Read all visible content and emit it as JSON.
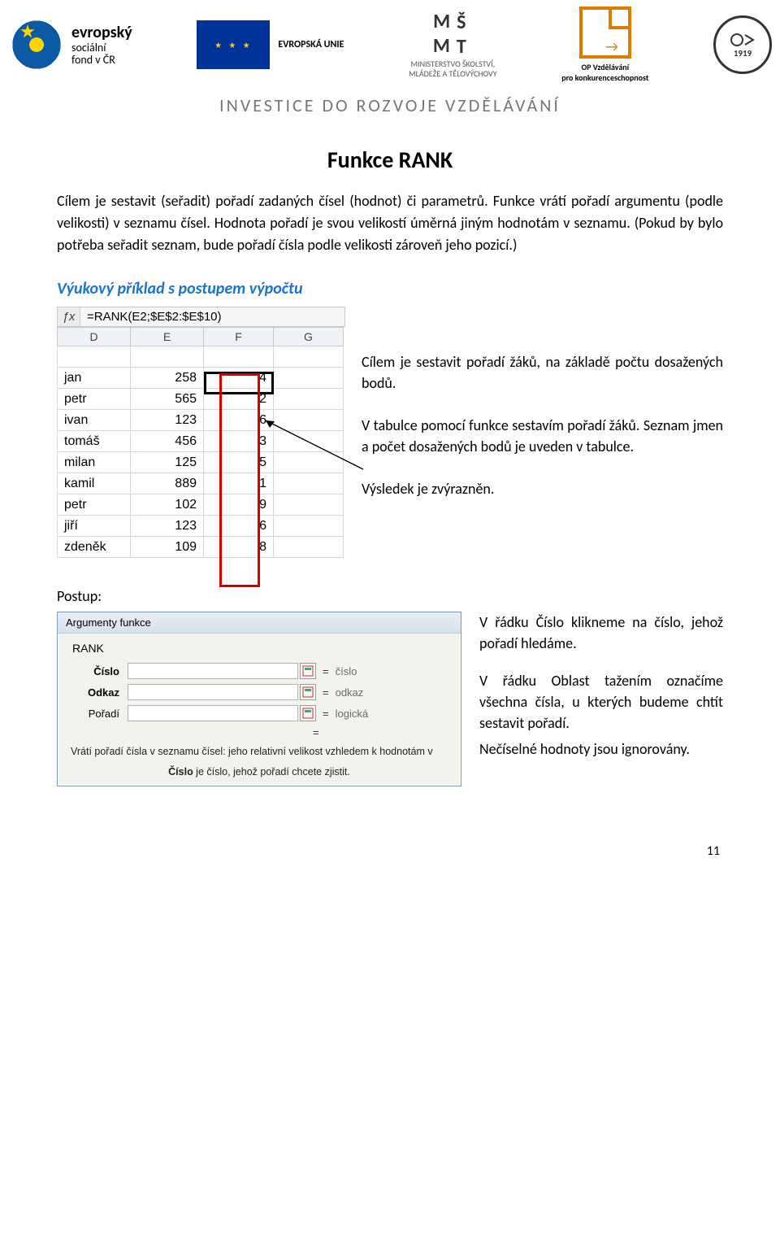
{
  "header": {
    "esf_big": "evropský",
    "esf_l2": "sociální",
    "esf_l3": "fond v ČR",
    "eu_label": "EVROPSKÁ UNIE",
    "msmt_top": "MŠMT",
    "msmt_l1": "MINISTERSTVO ŠKOLSTVÍ,",
    "msmt_l2": "MLÁDEŽE A TĚLOVÝCHOVY",
    "opvk_l1": "OP Vzdělávání",
    "opvk_l2": "pro konkurenceschopnost",
    "school_year": "1919",
    "slogan": "INVESTICE DO ROZVOJE VZDĚLÁVÁNÍ"
  },
  "title": "Funkce RANK",
  "intro_p1": "Cílem je sestavit (seřadit) pořadí zadaných čísel (hodnot) či parametrů. Funkce vrátí pořadí argumentu (podle velikosti) v seznamu čísel. Hodnota pořadí je svou velikostí úměrná jiným hodnotám v seznamu. (Pokud by bylo potřeba seřadit seznam, bude pořadí čísla podle velikosti zároveň jeho pozicí.)",
  "example_heading": "Výukový příklad s postupem výpočtu",
  "formula": "=RANK(E2;$E$2:$E$10)",
  "columns": [
    "D",
    "E",
    "F",
    "G"
  ],
  "rows": [
    {
      "name": "jan",
      "pts": 258,
      "rank": 4
    },
    {
      "name": "petr",
      "pts": 565,
      "rank": 2
    },
    {
      "name": "ivan",
      "pts": 123,
      "rank": 6
    },
    {
      "name": "tomáš",
      "pts": 456,
      "rank": 3
    },
    {
      "name": "milan",
      "pts": 125,
      "rank": 5
    },
    {
      "name": "kamil",
      "pts": 889,
      "rank": 1
    },
    {
      "name": "petr",
      "pts": 102,
      "rank": 9
    },
    {
      "name": "jiří",
      "pts": 123,
      "rank": 6
    },
    {
      "name": "zdeněk",
      "pts": 109,
      "rank": 8
    }
  ],
  "side": {
    "p1": "Cílem je sestavit pořadí žáků, na základě počtu dosažených bodů.",
    "p2": "V tabulce pomocí funkce sestavím pořadí žáků. Seznam jmen a počet dosažených bodů je uveden v tabulce.",
    "p3": "Výsledek je zvýrazněn."
  },
  "postup_label": "Postup:",
  "dialog": {
    "title": "Argumenty funkce",
    "fnname": "RANK",
    "args": [
      {
        "label": "Číslo",
        "bold": true,
        "value": "",
        "hint": "číslo"
      },
      {
        "label": "Odkaz",
        "bold": true,
        "value": "",
        "hint": "odkaz"
      },
      {
        "label": "Pořadí",
        "bold": false,
        "value": "",
        "hint": "logická"
      }
    ],
    "result_eq": "=",
    "desc": "Vrátí pořadí čísla v seznamu čísel: jeho relativní velikost vzhledem k hodnotám v",
    "desc2_label": "Číslo",
    "desc2_text": " je číslo, jehož pořadí chcete zjistit."
  },
  "right": {
    "p1": "V řádku Číslo klikneme na číslo, jehož pořadí hledáme.",
    "p2": "V řádku Oblast tažením označíme všechna čísla, u kterých budeme chtít sestavit pořadí.",
    "p3": "Nečíselné hodnoty jsou ignorovány."
  },
  "page_number": "11"
}
